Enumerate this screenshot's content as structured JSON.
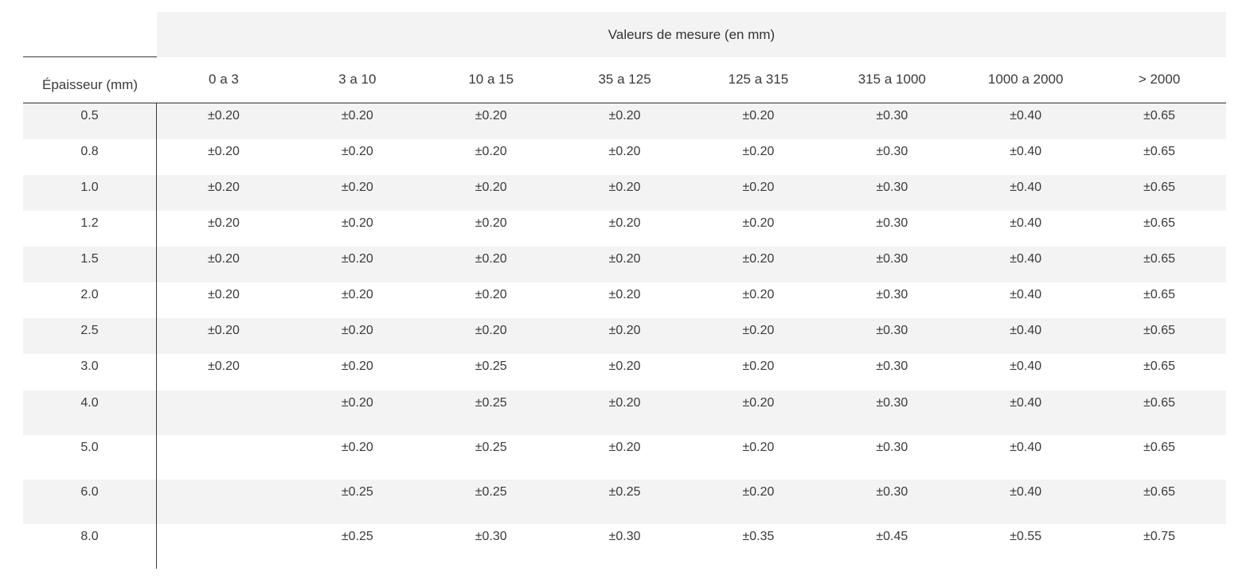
{
  "table": {
    "group_header": "Valeurs de mesure (en mm)",
    "row_header": "Épaisseur (mm)",
    "columns": [
      "0 a 3",
      "3 a 10",
      "10 a 15",
      "35 a 125",
      "125 a 315",
      "315 a 1000",
      "1000 a 2000",
      "> 2000"
    ],
    "rows": [
      {
        "thickness": "0.5",
        "values": [
          "±0.20",
          "±0.20",
          "±0.20",
          "±0.20",
          "±0.20",
          "±0.30",
          "±0.40",
          "±0.65"
        ]
      },
      {
        "thickness": "0.8",
        "values": [
          "±0.20",
          "±0.20",
          "±0.20",
          "±0.20",
          "±0.20",
          "±0.30",
          "±0.40",
          "±0.65"
        ]
      },
      {
        "thickness": "1.0",
        "values": [
          "±0.20",
          "±0.20",
          "±0.20",
          "±0.20",
          "±0.20",
          "±0.30",
          "±0.40",
          "±0.65"
        ]
      },
      {
        "thickness": "1.2",
        "values": [
          "±0.20",
          "±0.20",
          "±0.20",
          "±0.20",
          "±0.20",
          "±0.30",
          "±0.40",
          "±0.65"
        ]
      },
      {
        "thickness": "1.5",
        "values": [
          "±0.20",
          "±0.20",
          "±0.20",
          "±0.20",
          "±0.20",
          "±0.30",
          "±0.40",
          "±0.65"
        ]
      },
      {
        "thickness": "2.0",
        "values": [
          "±0.20",
          "±0.20",
          "±0.20",
          "±0.20",
          "±0.20",
          "±0.30",
          "±0.40",
          "±0.65"
        ]
      },
      {
        "thickness": "2.5",
        "values": [
          "±0.20",
          "±0.20",
          "±0.20",
          "±0.20",
          "±0.20",
          "±0.30",
          "±0.40",
          "±0.65"
        ]
      },
      {
        "thickness": "3.0",
        "values": [
          "±0.20",
          "±0.20",
          "±0.25",
          "±0.20",
          "±0.20",
          "±0.30",
          "±0.40",
          "±0.65"
        ]
      },
      {
        "thickness": "4.0",
        "values": [
          "",
          "±0.20",
          "±0.25",
          "±0.20",
          "±0.20",
          "±0.30",
          "±0.40",
          "±0.65"
        ]
      },
      {
        "thickness": "5.0",
        "values": [
          "",
          "±0.20",
          "±0.25",
          "±0.20",
          "±0.20",
          "±0.30",
          "±0.40",
          "±0.65"
        ]
      },
      {
        "thickness": "6.0",
        "values": [
          "",
          "±0.25",
          "±0.25",
          "±0.25",
          "±0.20",
          "±0.30",
          "±0.40",
          "±0.65"
        ]
      },
      {
        "thickness": "8.0",
        "values": [
          "",
          "±0.25",
          "±0.30",
          "±0.30",
          "±0.35",
          "±0.45",
          "±0.55",
          "±0.75"
        ]
      }
    ]
  }
}
